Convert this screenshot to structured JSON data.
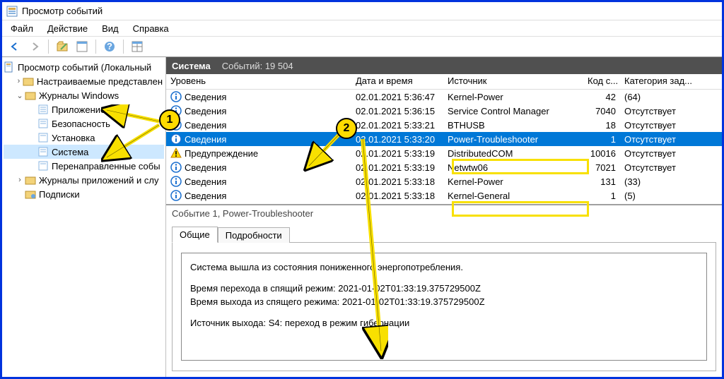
{
  "title": "Просмотр событий",
  "menu": [
    "Файл",
    "Действие",
    "Вид",
    "Справка"
  ],
  "tree": {
    "root": "Просмотр событий (Локальный",
    "custom": "Настраиваемые представлен",
    "winlogs": "Журналы Windows",
    "app": "Приложение",
    "sec": "Безопасность",
    "setup": "Установка",
    "system": "Система",
    "fwd": "Перенаправленные собы",
    "appsvcs": "Журналы приложений и слу",
    "subs": "Подписки"
  },
  "listheader": {
    "title": "Система",
    "count": "Событий: 19 504"
  },
  "columns": [
    "Уровень",
    "Дата и время",
    "Источник",
    "Код с...",
    "Категория зад..."
  ],
  "rows": [
    {
      "level": "Сведения",
      "icon": "info",
      "date": "02.01.2021 5:36:47",
      "source": "Kernel-Power",
      "code": "42",
      "cat": "(64)"
    },
    {
      "level": "Сведения",
      "icon": "info",
      "date": "02.01.2021 5:36:15",
      "source": "Service Control Manager",
      "code": "7040",
      "cat": "Отсутствует"
    },
    {
      "level": "Сведения",
      "icon": "info",
      "date": "02.01.2021 5:33:21",
      "source": "BTHUSB",
      "code": "18",
      "cat": "Отсутствует"
    },
    {
      "level": "Сведения",
      "icon": "info",
      "date": "02.01.2021 5:33:20",
      "source": "Power-Troubleshooter",
      "code": "1",
      "cat": "Отсутствует",
      "selected": true
    },
    {
      "level": "Предупреждение",
      "icon": "warn",
      "date": "02.01.2021 5:33:19",
      "source": "DistributedCOM",
      "code": "10016",
      "cat": "Отсутствует"
    },
    {
      "level": "Сведения",
      "icon": "info",
      "date": "02.01.2021 5:33:19",
      "source": "Netwtw06",
      "code": "7021",
      "cat": "Отсутствует"
    },
    {
      "level": "Сведения",
      "icon": "info",
      "date": "02.01.2021 5:33:18",
      "source": "Kernel-Power",
      "code": "131",
      "cat": "(33)"
    },
    {
      "level": "Сведения",
      "icon": "info",
      "date": "02.01.2021 5:33:18",
      "source": "Kernel-General",
      "code": "1",
      "cat": "(5)"
    }
  ],
  "details": {
    "title": "Событие 1, Power-Troubleshooter",
    "tabs": [
      "Общие",
      "Подробности"
    ],
    "lines": [
      "Система вышла из состояния пониженного энергопотребления.",
      "Время перехода в спящий режим: 2021-01-02T01:33:19.375729500Z",
      "Время выхода из спящего режима: 2021-01-02T01:33:19.375729500Z",
      "Источник выхода: S4: переход в режим гибернации"
    ]
  }
}
